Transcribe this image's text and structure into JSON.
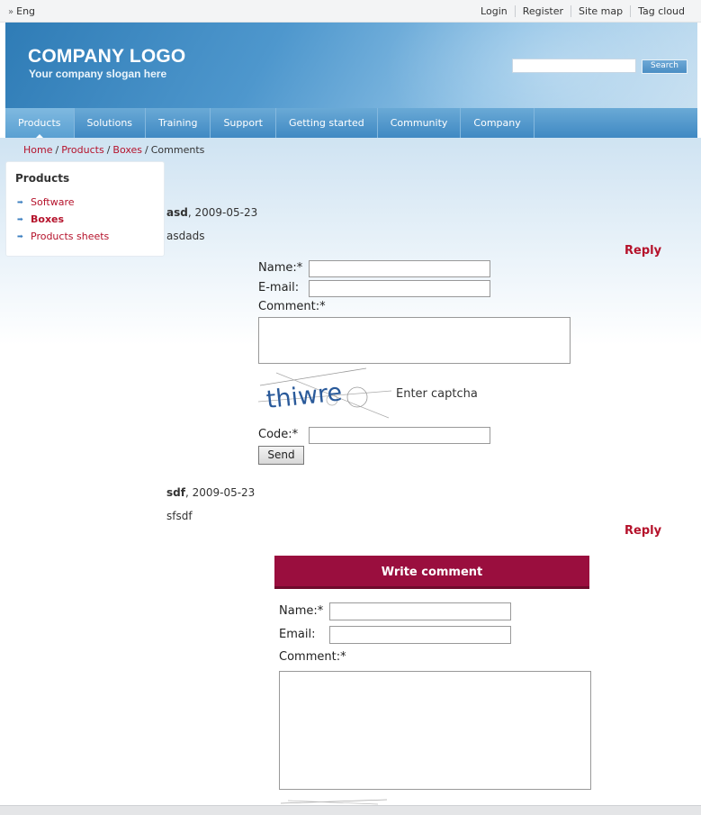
{
  "topbar": {
    "language": "Eng",
    "links": [
      "Login",
      "Register",
      "Site map",
      "Tag cloud"
    ]
  },
  "header": {
    "logo": "COMPANY LOGO",
    "slogan": "Your company slogan here",
    "search": {
      "value": "",
      "button_label": "Search"
    }
  },
  "nav": {
    "items": [
      "Products",
      "Solutions",
      "Training",
      "Support",
      "Getting started",
      "Community",
      "Company"
    ],
    "active_index": 0
  },
  "breadcrumb": {
    "links": [
      "Home",
      "Products",
      "Boxes"
    ],
    "separator": "/",
    "current": "Comments"
  },
  "sidebar": {
    "title": "Products",
    "items": [
      {
        "label": "Software"
      },
      {
        "label": "Boxes",
        "active": true
      },
      {
        "label": "Products sheets"
      }
    ]
  },
  "comments": [
    {
      "author": "asd",
      "date": ", 2009-05-23",
      "text": "asdads",
      "reply_label": "Reply"
    },
    {
      "author": "sdf",
      "date": ", 2009-05-23",
      "text": "sfsdf",
      "reply_label": "Reply"
    }
  ],
  "reply_form": {
    "name_label": "Name:*",
    "email_label": "E-mail:",
    "comment_label": "Comment:*",
    "captcha_image_text": "thiwre",
    "captcha_prompt": "Enter captcha",
    "code_label": "Code:*",
    "send_label": "Send"
  },
  "write_comment": {
    "title": "Write comment",
    "name_label": "Name:*",
    "email_label": "Email:",
    "comment_label": "Comment:*"
  },
  "colors": {
    "accent": "#b5122b",
    "header_blue": "#3f89c3",
    "write_header": "#9a0e3e"
  }
}
